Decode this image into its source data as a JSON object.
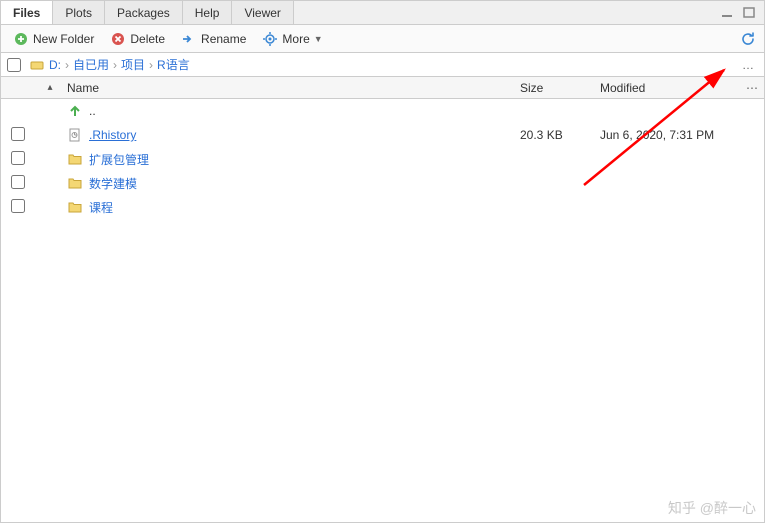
{
  "tabs": {
    "items": [
      "Files",
      "Plots",
      "Packages",
      "Help",
      "Viewer"
    ],
    "active_index": 0
  },
  "toolbar": {
    "new_folder": "New Folder",
    "delete": "Delete",
    "rename": "Rename",
    "more": "More"
  },
  "breadcrumb": {
    "root": "D:",
    "parts": [
      "自已用",
      "项目",
      "R语言"
    ]
  },
  "columns": {
    "name": "Name",
    "size": "Size",
    "modified": "Modified"
  },
  "rows": [
    {
      "type": "up",
      "name": "..",
      "size": "",
      "modified": ""
    },
    {
      "type": "file",
      "name": ".Rhistory",
      "size": "20.3 KB",
      "modified": "Jun 6, 2020, 7:31 PM"
    },
    {
      "type": "folder",
      "name": "扩展包管理",
      "size": "",
      "modified": ""
    },
    {
      "type": "folder",
      "name": "数学建模",
      "size": "",
      "modified": ""
    },
    {
      "type": "folder",
      "name": "课程",
      "size": "",
      "modified": ""
    }
  ],
  "watermark": "知乎 @醉一心"
}
